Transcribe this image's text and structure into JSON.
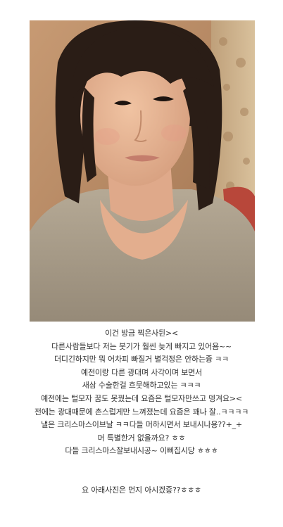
{
  "photo": {
    "icon": "selfie-photo",
    "colors": {
      "background": "#b98d68",
      "hair": "#2a1d16",
      "skin": "#e6b596",
      "shirt": "#a89c8c",
      "curtain": "#cbb08c"
    }
  },
  "caption": {
    "lines": [
      "이건 방금 찍은사뒨>< ",
      "다른사람들보다 저는 붓기가 훨씬 늦게 빠지고 있어욤~~",
      "더디긴하지만 뭐 어차피 빠질거 별걱정은 안하는즁 ㅋㅋ",
      "예전이랑 다른 광대며 사각이며 보면서",
      "새삼 수술한걸 흐뭇해하고있는 ㅋㅋㅋ",
      "예전에는 털모자 꿈도 못꿨는데 요즘은 털모자만쓰고 뎅겨요><",
      "전에는 광대때문에 촌스럽게만 느껴졌는데 요즘은 꽤나 잘..ㅋㅋㅋㅋ",
      "낼은 크리스마스이브날 ㅋㅋ다들 머하시면서 보내시나용??+_+",
      "머 특별한거 없을까요? ㅎㅎ",
      "다들 크리스마스잘보내시공~ 이뻐집시당 ㅎㅎㅎ"
    ],
    "footer": "요 아래사진은 먼지 아시겠죵??ㅎㅎㅎ"
  }
}
